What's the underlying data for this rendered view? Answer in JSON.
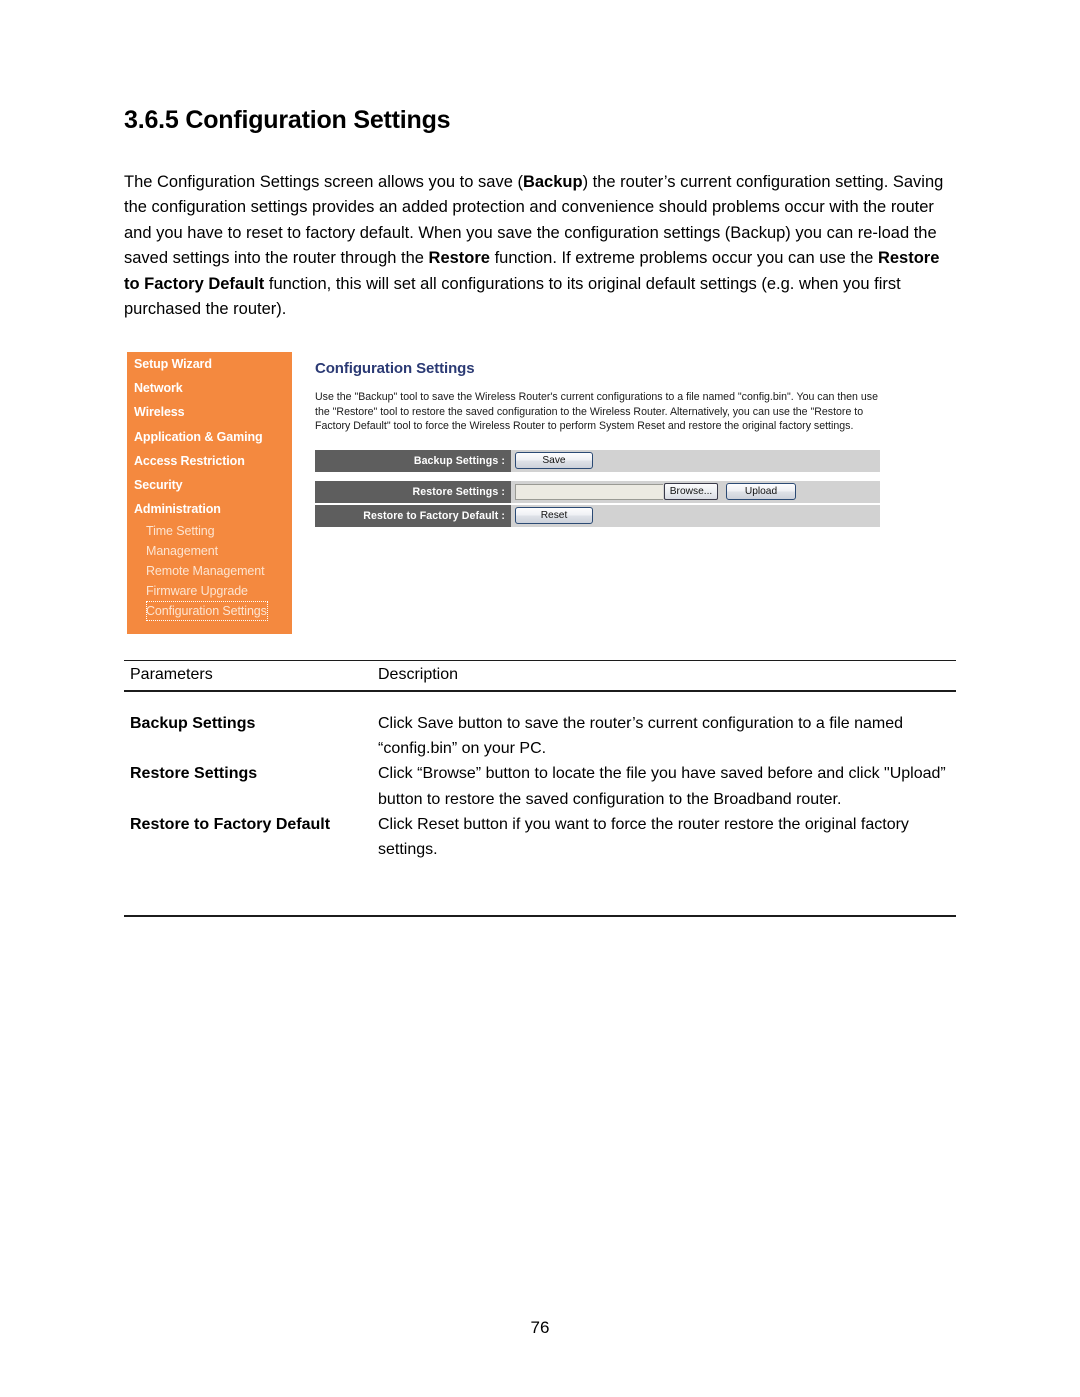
{
  "document": {
    "heading": "3.6.5 Configuration Settings",
    "intro_runs": [
      {
        "text": "The Configuration Settings screen allows you to save (",
        "bold": false
      },
      {
        "text": "Backup",
        "bold": true
      },
      {
        "text": ") the router’s current configuration setting. Saving the configuration settings provides an added protection and convenience should problems occur with the router and you have to reset to factory default. When you save the configuration settings (Backup) you can re-load the saved settings into the router through the ",
        "bold": false
      },
      {
        "text": "Restore",
        "bold": true
      },
      {
        "text": " function. If extreme problems occur you can use the ",
        "bold": false
      },
      {
        "text": "Restore to Factory Default",
        "bold": true
      },
      {
        "text": " function, this will set all configurations to its original default settings (e.g. when you first purchased the router).",
        "bold": false
      }
    ],
    "page_number": "76"
  },
  "router_ui": {
    "sidebar": {
      "main_items": [
        {
          "label": "Setup Wizard"
        },
        {
          "label": "Network"
        },
        {
          "label": "Wireless"
        },
        {
          "label": "Application & Gaming"
        },
        {
          "label": "Access Restriction"
        },
        {
          "label": "Security"
        },
        {
          "label": "Administration"
        }
      ],
      "sub_items": [
        {
          "label": "Time Setting",
          "selected": false
        },
        {
          "label": "Management",
          "selected": false
        },
        {
          "label": "Remote Management",
          "selected": false
        },
        {
          "label": "Firmware Upgrade",
          "selected": false
        },
        {
          "label": "Configuration Settings",
          "selected": true
        }
      ],
      "background_color": "#f4893f",
      "text_color": "#ffffff",
      "sub_text_color": "#fde4d0"
    },
    "panel": {
      "title": "Configuration Settings",
      "title_color": "#2b3a74",
      "description": "Use the \"Backup\" tool to save the Wireless Router's current configurations to a file named \"config.bin\". You can then use the \"Restore\" tool to restore the saved configuration to the Wireless Router. Alternatively, you can use the \"Restore to Factory Default\" tool to force the Wireless Router to perform System Reset and restore the original factory settings.",
      "rows": [
        {
          "label": "Backup Settings :",
          "control": "button",
          "button_label": "Save"
        },
        {
          "label": "Restore Settings :",
          "control": "file",
          "file_value": "",
          "browse_label": "Browse...",
          "upload_label": "Upload"
        },
        {
          "label": "Restore to Factory Default :",
          "control": "button",
          "button_label": "Reset"
        }
      ],
      "label_bg_color": "#5e5e5e",
      "value_bg_color": "#d2d2d2"
    }
  },
  "param_table": {
    "headers": {
      "parameters": "Parameters",
      "description": "Description"
    },
    "rows": [
      {
        "parameter": "Backup Settings",
        "description": "Click Save button to save the router’s current configuration to a file named “config.bin” on your PC."
      },
      {
        "parameter": "Restore Settings",
        "description": "Click “Browse” button to locate the file you have saved before and click \"Upload” button to restore the saved configuration to the Broadband router."
      },
      {
        "parameter": "Restore to Factory Default",
        "description": "Click Reset button if you want to force the router restore the original factory settings."
      }
    ]
  }
}
